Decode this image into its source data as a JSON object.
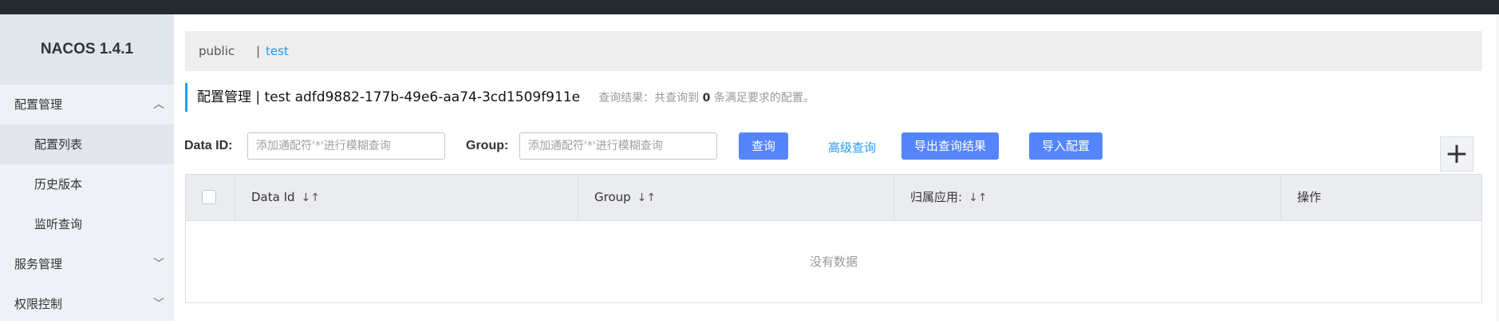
{
  "app": {
    "logo": "NACOS 1.4.1"
  },
  "sidebar": {
    "groups": [
      {
        "label": "配置管理",
        "expanded": true,
        "chevron": "chevron-up-icon",
        "items": [
          {
            "label": "配置列表",
            "active": true
          },
          {
            "label": "历史版本"
          },
          {
            "label": "监听查询"
          }
        ]
      },
      {
        "label": "服务管理",
        "expanded": false,
        "chevron": "chevron-down-icon"
      },
      {
        "label": "权限控制",
        "expanded": false,
        "chevron": "chevron-down-icon"
      }
    ]
  },
  "namespaces": {
    "items": [
      "public",
      "test"
    ],
    "separator": "|",
    "active": "test"
  },
  "page_title": {
    "text": "配置管理  |  test  adfd9882-177b-49e6-aa74-3cd1509f911e",
    "result_prefix": "查询结果：共查询到",
    "result_count": "0",
    "result_suffix": "条满足要求的配置。"
  },
  "filters": {
    "data_id_label": "Data ID:",
    "data_id_placeholder": "添加通配符'*'进行模糊查询",
    "data_id_value": "",
    "group_label": "Group:",
    "group_placeholder": "添加通配符'*'进行模糊查询",
    "group_value": "",
    "query_button": "查询",
    "advanced_query": "高级查询",
    "export_button": "导出查询结果",
    "import_button": "导入配置",
    "add_button": "+"
  },
  "table": {
    "columns": [
      "Data Id",
      "Group",
      "归属应用:",
      "操作"
    ],
    "sort_icon": "↓↑",
    "empty_text": "没有数据",
    "rows": []
  },
  "colors": {
    "accent": "#209bfa",
    "button": "#5584ff",
    "topbar": "#252a2f",
    "sidebar": "#eef1f6"
  }
}
